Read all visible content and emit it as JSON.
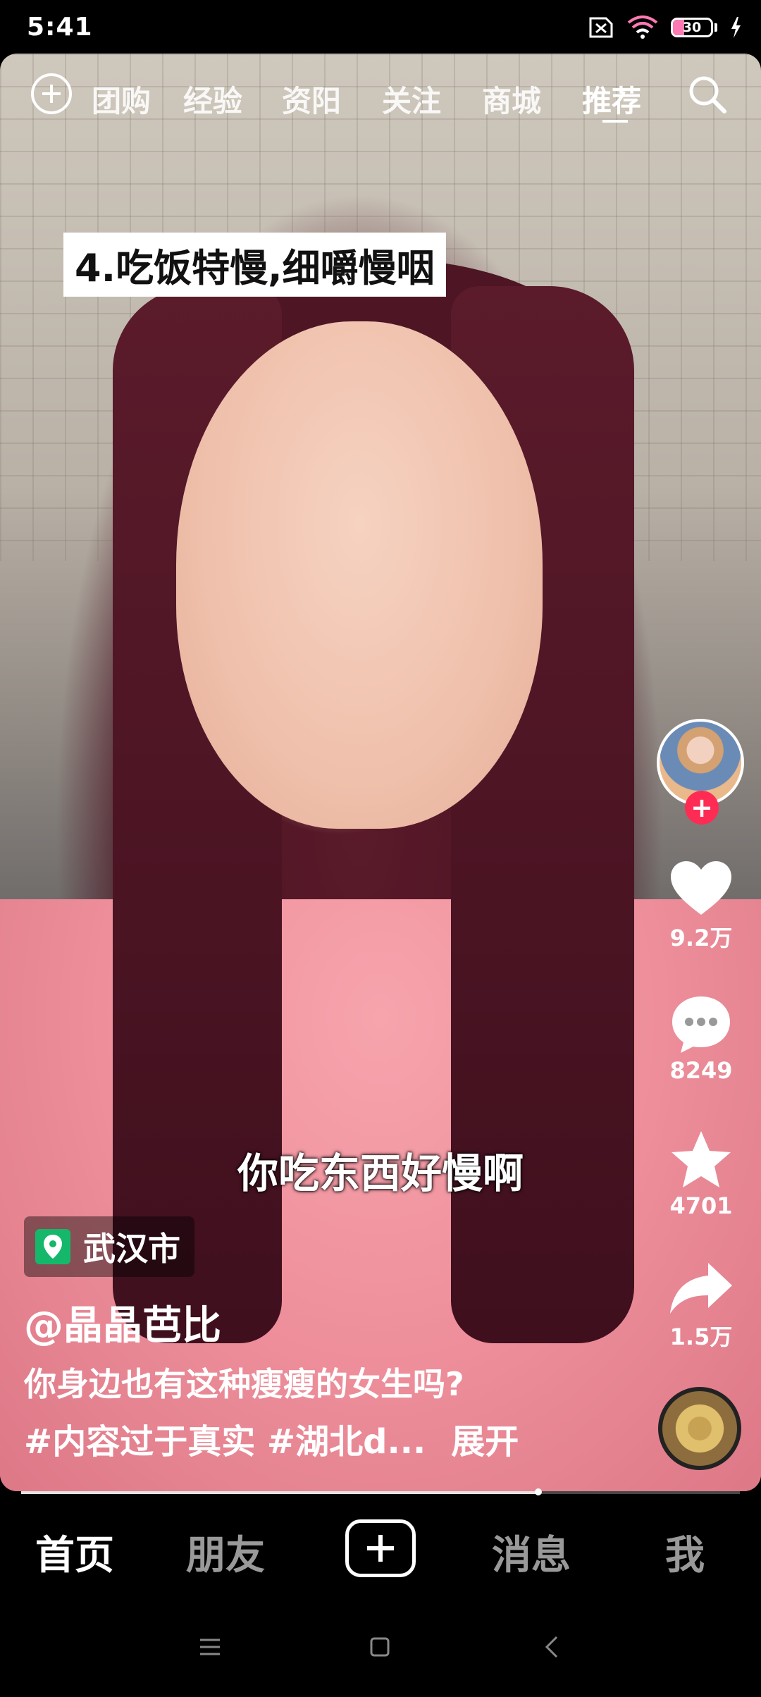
{
  "status_bar": {
    "time": "5:41",
    "battery": "30"
  },
  "top_tabs": [
    {
      "label": "团购"
    },
    {
      "label": "经验"
    },
    {
      "label": "资阳"
    },
    {
      "label": "关注"
    },
    {
      "label": "商城"
    },
    {
      "label": "推荐"
    }
  ],
  "video": {
    "caption": "4.吃饭特慢,细嚼慢咽",
    "subtitle": "你吃东西好慢啊",
    "location": "武汉市",
    "author": "@晶晶芭比",
    "description": "你身边也有这种瘦瘦的女生吗?",
    "hashtags": "#内容过于真实 #湖北d...",
    "expand_label": "展开",
    "progress": 0.72
  },
  "actions": {
    "likes": "9.2万",
    "comments": "8249",
    "favorites": "4701",
    "shares": "1.5万"
  },
  "bottom_nav": {
    "home": "首页",
    "friends": "朋友",
    "messages": "消息",
    "me": "我"
  },
  "colors": {
    "accent": "#fe2c55",
    "location_icon": "#15b86a"
  }
}
